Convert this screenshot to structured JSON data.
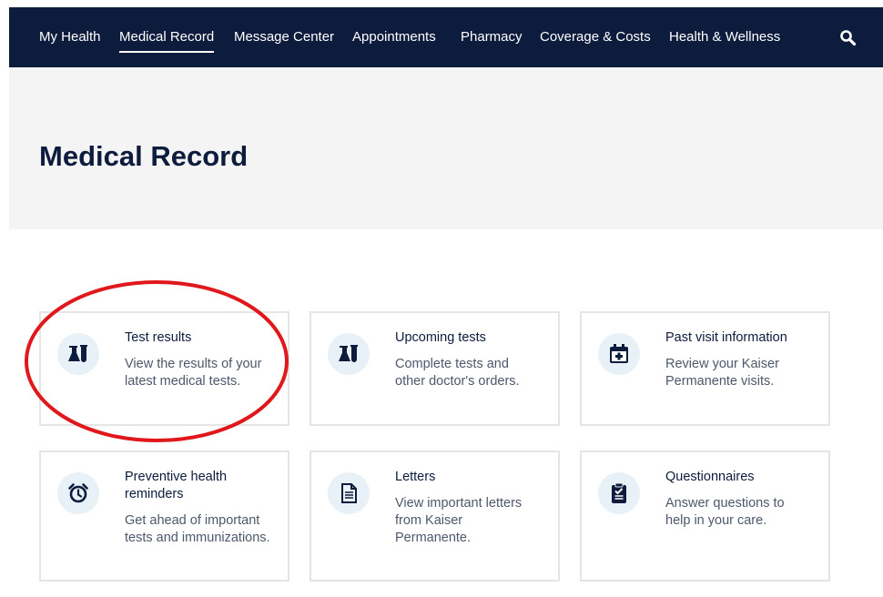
{
  "nav": {
    "items": [
      "My Health",
      "Medical Record",
      "Message Center",
      "Appointments",
      "Pharmacy",
      "Coverage & Costs",
      "Health & Wellness"
    ],
    "active": "Medical Record",
    "search_icon": "search-icon"
  },
  "page": {
    "title": "Medical Record"
  },
  "cards": [
    {
      "title": "Test results",
      "description": "View the results of your latest medical tests.",
      "icon": "lab-flask-icon"
    },
    {
      "title": "Upcoming tests",
      "description": "Complete tests and other doctor's orders.",
      "icon": "lab-flask-icon"
    },
    {
      "title": "Past visit information",
      "description": "Review your Kaiser Permanente visits.",
      "icon": "calendar-medical-icon"
    },
    {
      "title": "Preventive health reminders",
      "description": "Get ahead of important tests and immunizations.",
      "icon": "alarm-clock-icon"
    },
    {
      "title": "Letters",
      "description": "View important letters from Kaiser Permanente.",
      "icon": "document-icon"
    },
    {
      "title": "Questionnaires",
      "description": "Answer questions to help in your care.",
      "icon": "clipboard-check-icon"
    }
  ],
  "colors": {
    "navy": "#0d1c3d",
    "icon_bg": "#e8f1f7",
    "annotation": "#e0181b"
  }
}
